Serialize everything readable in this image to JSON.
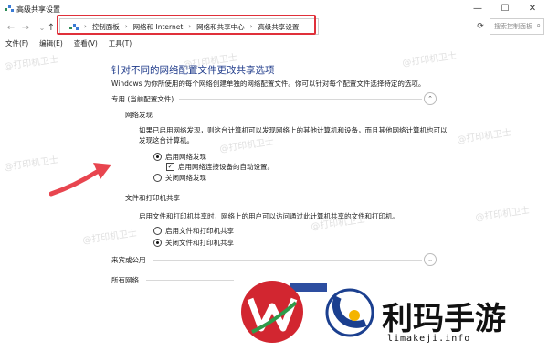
{
  "window": {
    "title": "高级共享设置",
    "controls": {
      "minimize": "—",
      "maximize": "☐",
      "close": "✕"
    }
  },
  "navigation": {
    "back": "←",
    "forward": "→",
    "up": "↑",
    "breadcrumbs": [
      "控制面板",
      "网络和 Internet",
      "网络和共享中心",
      "高级共享设置"
    ],
    "search_placeholder": "搜索控制面板"
  },
  "menu": [
    "文件(F)",
    "编辑(E)",
    "查看(V)",
    "工具(T)"
  ],
  "page": {
    "heading": "针对不同的网络配置文件更改共享选项",
    "description": "Windows 为你所使用的每个网络创建单独的网络配置文件。你可以针对每个配置文件选择特定的选项。",
    "profile_private": "专用 (当前配置文件)",
    "network_discovery": {
      "title": "网络发现",
      "text": "如果已启用网络发现，则这台计算机可以发现网络上的其他计算机和设备，而且其他网络计算机也可以发现这台计算机。",
      "options": [
        {
          "label": "启用网络发现",
          "selected": true
        },
        {
          "label": "关闭网络发现",
          "selected": false
        }
      ],
      "auto_setup": {
        "label": "启用网络连接设备的自动设置。",
        "checked": true
      }
    },
    "file_printer_sharing": {
      "title": "文件和打印机共享",
      "text": "启用文件和打印机共享时，网络上的用户可以访问通过此计算机共享的文件和打印机。",
      "options": [
        {
          "label": "启用文件和打印机共享",
          "selected": false
        },
        {
          "label": "关闭文件和打印机共享",
          "selected": true
        }
      ]
    },
    "profile_guest": "来宾或公用",
    "profile_all": "所有网络"
  },
  "watermark": "@打印机卫士",
  "overlay": {
    "brand_text": "利玛手游",
    "brand_url": "limakeji.info"
  },
  "colors": {
    "heading_blue": "#1e3a8a",
    "highlight_red": "#e0303a",
    "arrow_red": "#e8454f"
  }
}
